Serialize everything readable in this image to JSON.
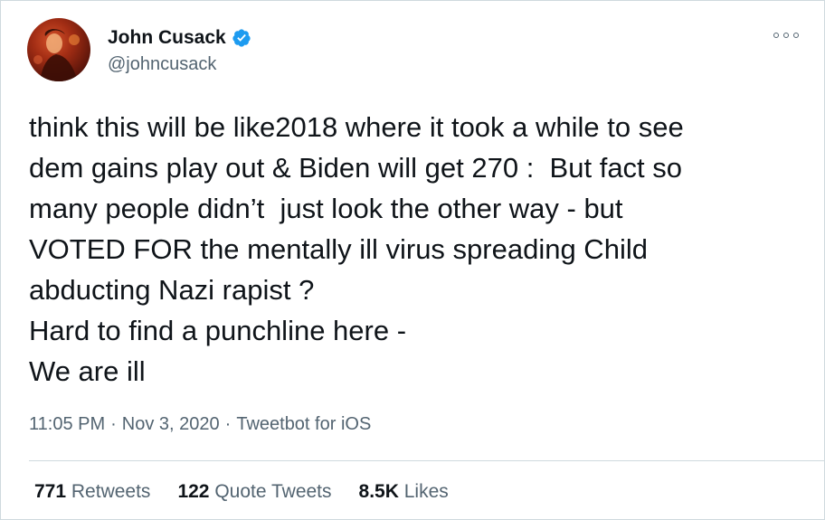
{
  "author": {
    "display_name": "John Cusack",
    "handle": "@johncusack",
    "verified": true,
    "avatar_icon": "profile-photo"
  },
  "menu_icon": "more-options-icon",
  "tweet": {
    "text": "think this will be like2018 where it took a while to see\ndem gains play out & Biden will get 270 :  But fact so\nmany people didn’t  just look the other way - but\nVOTED FOR the mentally ill virus spreading Child\nabducting Nazi rapist ?\nHard to find a punchline here -\nWe are ill",
    "time": "11:05 PM",
    "date": "Nov 3, 2020",
    "source": "Tweetbot for iOS",
    "separator": "·"
  },
  "stats": {
    "retweets_count": "771",
    "retweets_label": "Retweets",
    "quotes_count": "122",
    "quotes_label": "Quote Tweets",
    "likes_count": "8.5K",
    "likes_label": "Likes"
  },
  "colors": {
    "verified_badge": "#1d9bf0",
    "secondary_text": "#536471",
    "primary_text": "#0f1419",
    "border": "#cfd9de"
  }
}
